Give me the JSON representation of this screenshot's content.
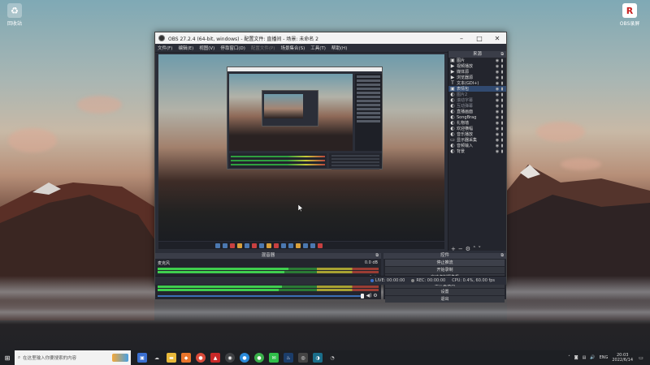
{
  "desktop": {
    "icons": [
      {
        "label": "回收站",
        "icon": "recycle-bin-icon"
      },
      {
        "label": "OBS录屏",
        "icon": "app-icon"
      }
    ]
  },
  "obs": {
    "title": "OBS 27.2.4 (64-bit, windows) - 配置文件: 直播间 - 场景: 未命名 2",
    "menu": [
      {
        "label": "文件(F)",
        "disabled": false
      },
      {
        "label": "编辑(E)",
        "disabled": false
      },
      {
        "label": "视图(V)",
        "disabled": false
      },
      {
        "label": "停靠窗口(D)",
        "disabled": false
      },
      {
        "label": "配置文件(P)",
        "disabled": true
      },
      {
        "label": "场景集合(S)",
        "disabled": false
      },
      {
        "label": "工具(T)",
        "disabled": false
      },
      {
        "label": "帮助(H)",
        "disabled": false
      }
    ],
    "sources_title": "来源",
    "sources": [
      {
        "icon": "image-icon",
        "name": "图片",
        "sel": false,
        "dim": false
      },
      {
        "icon": "play-icon",
        "name": "视频播放",
        "sel": false,
        "dim": false
      },
      {
        "icon": "play-icon",
        "name": "媒体源",
        "sel": false,
        "dim": false
      },
      {
        "icon": "play-icon",
        "name": "浏览器源",
        "sel": false,
        "dim": false
      },
      {
        "icon": "text-icon",
        "name": "文本(GDI+)",
        "sel": false,
        "dim": false
      },
      {
        "icon": "image-icon",
        "name": "表情包",
        "sel": true,
        "dim": false
      },
      {
        "icon": "globe-icon",
        "name": "图片2",
        "sel": false,
        "dim": true
      },
      {
        "icon": "globe-icon",
        "name": "滚动字幕",
        "sel": false,
        "dim": true
      },
      {
        "icon": "globe-icon",
        "name": "互动弹幕",
        "sel": false,
        "dim": true
      },
      {
        "icon": "globe-icon",
        "name": "直播画面",
        "sel": false,
        "dim": false
      },
      {
        "icon": "globe-icon",
        "name": "SongBrag",
        "sel": false,
        "dim": false
      },
      {
        "icon": "globe-icon",
        "name": "礼物墙",
        "sel": false,
        "dim": false
      },
      {
        "icon": "globe-icon",
        "name": "欢迎横幅",
        "sel": false,
        "dim": false
      },
      {
        "icon": "globe-icon",
        "name": "音乐播放",
        "sel": false,
        "dim": false
      },
      {
        "icon": "monitor-icon",
        "name": "显示器采集",
        "sel": false,
        "dim": false
      },
      {
        "icon": "globe-icon",
        "name": "音频输入",
        "sel": false,
        "dim": false
      },
      {
        "icon": "globe-icon",
        "name": "背景",
        "sel": false,
        "dim": false
      }
    ],
    "mixer_title": "混音器",
    "channels": [
      {
        "name": "麦克风",
        "db": "0.0 dB",
        "level": 0.82
      },
      {
        "name": "桌面音频",
        "db": "0.0 dB",
        "level": 0.78
      }
    ],
    "controls_title": "控件",
    "controls": [
      {
        "label": "停止推流",
        "active": true
      },
      {
        "label": "开始录制",
        "active": false
      },
      {
        "label": "启动虚拟摄像机",
        "active": false
      },
      {
        "label": "工作室模式",
        "active": false
      },
      {
        "label": "设置",
        "active": false
      },
      {
        "label": "退出",
        "active": false
      }
    ],
    "status": {
      "live": "LIVE: 00:00:00",
      "rec": "REC: 00:00:00",
      "cpu": "CPU: 0.4%, 60.00 fps"
    }
  },
  "taskbar": {
    "search_placeholder": "在这里输入你要搜索的内容",
    "time": "20:03",
    "date": "2022/6/14",
    "lang": "ENG"
  }
}
